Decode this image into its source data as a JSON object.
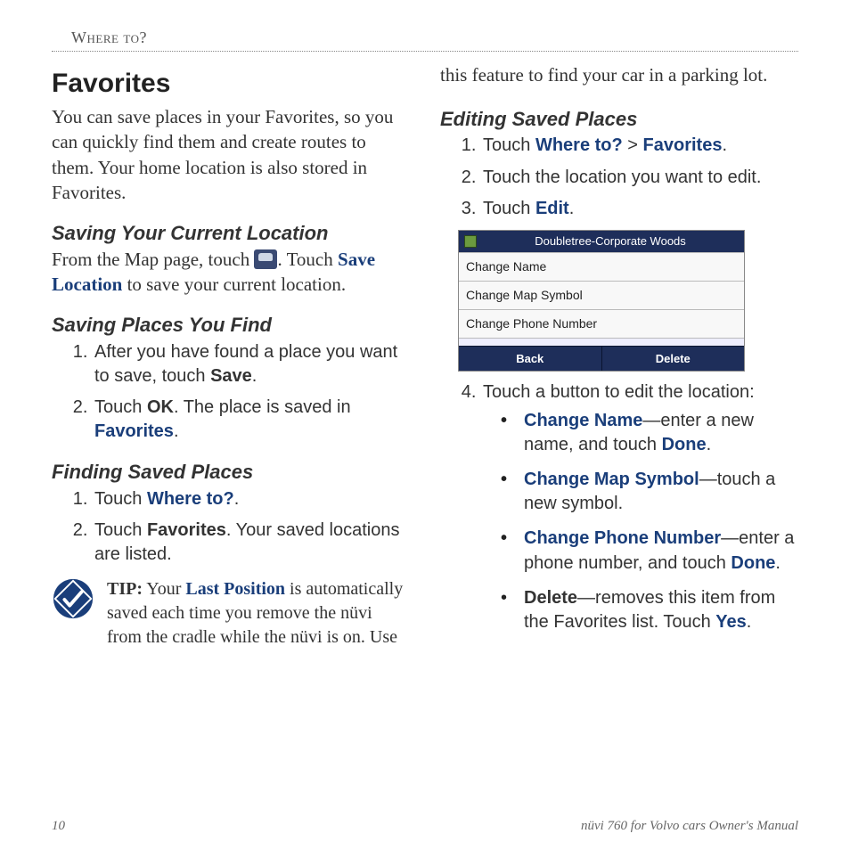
{
  "header": "Where to?",
  "left": {
    "h1": "Favorites",
    "intro": "You can save places in your Favorites, so you can quickly find them and create routes to them. Your home location is also stored in Favorites.",
    "h2a": "Saving Your Current Location",
    "p2a_pre": "From the Map page, touch ",
    "p2a_mid": ". Touch ",
    "p2a_link": "Save Location",
    "p2a_post": " to save your current location.",
    "h2b": "Saving Places You Find",
    "ol_b": [
      {
        "pre": "After you have found a place you want to save, touch ",
        "b": "Save",
        "post": "."
      },
      {
        "pre": "Touch ",
        "b": "OK",
        "mid": ". The place is saved in ",
        "blue": "Favorites",
        "post": "."
      }
    ],
    "h2c": "Finding Saved Places",
    "ol_c": [
      {
        "pre": "Touch ",
        "blue": "Where to?",
        "post": "."
      },
      {
        "pre": "Touch ",
        "b": "Favorites",
        "post": ". Your saved locations are listed."
      }
    ],
    "tip": {
      "label": "TIP:",
      "pre": " Your ",
      "b": "Last Position",
      "post": " is automatically saved each time you remove the nüvi from the cradle while the nüvi is on. Use"
    }
  },
  "right": {
    "cont": "this feature to find your car in a parking lot.",
    "h2": "Editing Saved Places",
    "ol": [
      {
        "pre": "Touch ",
        "blue1": "Where to?",
        "mid": " > ",
        "blue2": "Favorites",
        "post": "."
      },
      {
        "text": "Touch the location you want to edit."
      },
      {
        "pre": "Touch ",
        "blue": "Edit",
        "post": "."
      }
    ],
    "device": {
      "title": "Doubletree-Corporate Woods",
      "rows": [
        "Change Name",
        "Change Map Symbol",
        "Change Phone Number"
      ],
      "buttons": [
        "Back",
        "Delete"
      ]
    },
    "step4": "Touch a button to edit the location:",
    "bullets": [
      {
        "blue": "Change Name",
        "rest": "—enter a new name, and touch ",
        "b": "Done",
        "post": "."
      },
      {
        "blue": "Change Map Symbol",
        "rest": "—touch a new symbol."
      },
      {
        "blue": "Change Phone Number",
        "rest": "—enter a phone number, and touch ",
        "b": "Done",
        "post": "."
      },
      {
        "b": "Delete",
        "rest": "—removes this item from the Favorites list. Touch ",
        "b2": "Yes",
        "post": ".",
        "open": true
      }
    ]
  },
  "footer": {
    "page": "10",
    "title": "nüvi 760 for Volvo cars Owner's Manual"
  }
}
